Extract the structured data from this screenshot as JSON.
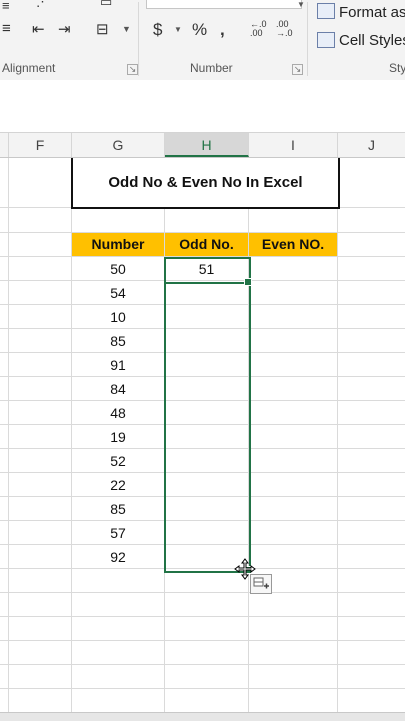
{
  "ribbon": {
    "groups": [
      {
        "name": "Alignment"
      },
      {
        "name": "Number"
      },
      {
        "name": "Sty"
      }
    ],
    "number": {
      "currency_symbol": "$",
      "percent_symbol": "%",
      "comma_symbol": ",",
      "increase_decimal": "←.0 .00",
      "decrease_decimal": ".00 →.0"
    },
    "styles": {
      "format_as": "Format as",
      "cell_styles": "Cell Styles"
    }
  },
  "columns": [
    "F",
    "G",
    "H",
    "I",
    "J"
  ],
  "selected_column": "H",
  "sheet": {
    "title": "Odd No & Even No In Excel",
    "headers": {
      "number": "Number",
      "odd": "Odd No.",
      "even": "Even NO."
    },
    "numbers": [
      "50",
      "54",
      "10",
      "85",
      "91",
      "84",
      "48",
      "19",
      "52",
      "22",
      "85",
      "57",
      "92"
    ],
    "odd_values": [
      "51"
    ]
  },
  "colors": {
    "header_fill": "#ffc000",
    "selection": "#217346"
  }
}
